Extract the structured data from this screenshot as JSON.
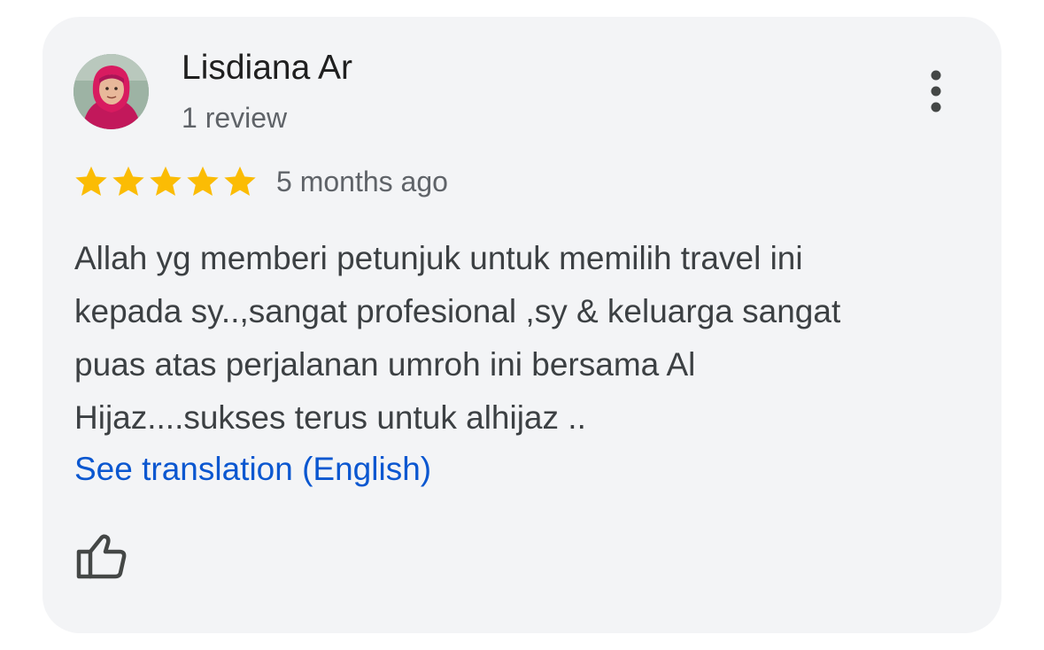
{
  "review": {
    "author_name": "Lisdiana Ar",
    "author_review_count": "1 review",
    "rating": 5,
    "rating_max": 5,
    "time_ago": "5 months ago",
    "text": "Allah yg memberi petunjuk untuk memilih travel ini\nkepada sy..,sangat profesional ,sy & keluarga sangat\npuas atas perjalanan umroh ini bersama Al\nHijaz....sukses terus untuk alhijaz ..",
    "translate_link": "See translation (English)"
  },
  "icons": {
    "menu": "more-vert-icon",
    "like": "thumb-up-outline-icon",
    "star": "star-icon"
  },
  "colors": {
    "star": "#fbbc04",
    "link": "#0b57d0",
    "card_bg": "#f3f4f6"
  }
}
